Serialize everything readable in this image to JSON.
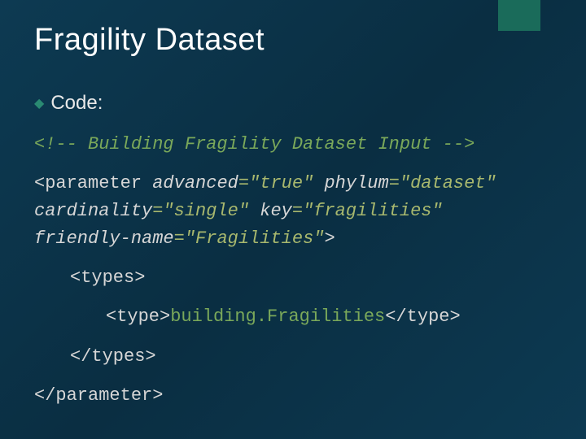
{
  "title": "Fragility Dataset",
  "bullet_label": "Code:",
  "code": {
    "comment": "<!-- Building Fragility Dataset Input -->",
    "param_open_1a": "<parameter ",
    "attr_advanced_name": "advanced",
    "attr_advanced_val": "=\"true\" ",
    "attr_phylum_name": "phylum",
    "attr_phylum_val": "=\"dataset\" ",
    "attr_cardinality_name": "cardinality",
    "attr_cardinality_val": "=\"single\" ",
    "attr_key_name": "key",
    "attr_key_val": "=\"fragilities\" ",
    "attr_friendly_name": "friendly-name",
    "attr_friendly_val": "=\"Fragilities\"",
    "param_open_end": ">",
    "types_open": "<types>",
    "type_open": "<type>",
    "type_value": "building.Fragilities",
    "type_close": "</type>",
    "types_close": "</types>",
    "param_close": "</parameter>"
  }
}
